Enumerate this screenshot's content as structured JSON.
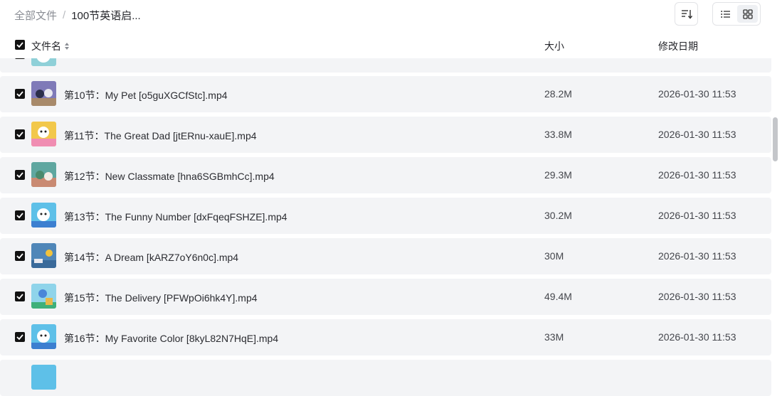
{
  "breadcrumb": {
    "root": "全部文件",
    "separator": "/",
    "current": "100节英语启..."
  },
  "toolbar": {
    "sort_icon": "sort-icon",
    "list_view_icon": "list-view-icon",
    "grid_view_icon": "grid-view-icon",
    "active_view": "list"
  },
  "table": {
    "headers": {
      "name": "文件名",
      "size": "大小",
      "date": "修改日期"
    },
    "rows": [
      {
        "name": "第10节：My Pet [o5guXGCfStc].mp4",
        "size": "28.2M",
        "date": "2026-01-30 11:53",
        "checked": true
      },
      {
        "name": "第11节：The Great Dad [jtERnu-xauE].mp4",
        "size": "33.8M",
        "date": "2026-01-30 11:53",
        "checked": true
      },
      {
        "name": "第12节：New Classmate [hna6SGBmhCc].mp4",
        "size": "29.3M",
        "date": "2026-01-30 11:53",
        "checked": true
      },
      {
        "name": "第13节：The Funny Number [dxFqeqFSHZE].mp4",
        "size": "30.2M",
        "date": "2026-01-30 11:53",
        "checked": true
      },
      {
        "name": "第14节：A Dream [kARZ7oY6n0c].mp4",
        "size": "30M",
        "date": "2026-01-30 11:53",
        "checked": true
      },
      {
        "name": "第15节：The Delivery [PFWpOi6hk4Y].mp4",
        "size": "49.4M",
        "date": "2026-01-30 11:53",
        "checked": true
      },
      {
        "name": "第16节：My Favorite Color [8kyL82N7HqE].mp4",
        "size": "33M",
        "date": "2026-01-30 11:53",
        "checked": true
      }
    ]
  },
  "colors": {
    "row_bg": "#f3f4f6",
    "checkbox": "#121212",
    "accent_text": "#25262b",
    "muted_text": "#8a8d94"
  }
}
